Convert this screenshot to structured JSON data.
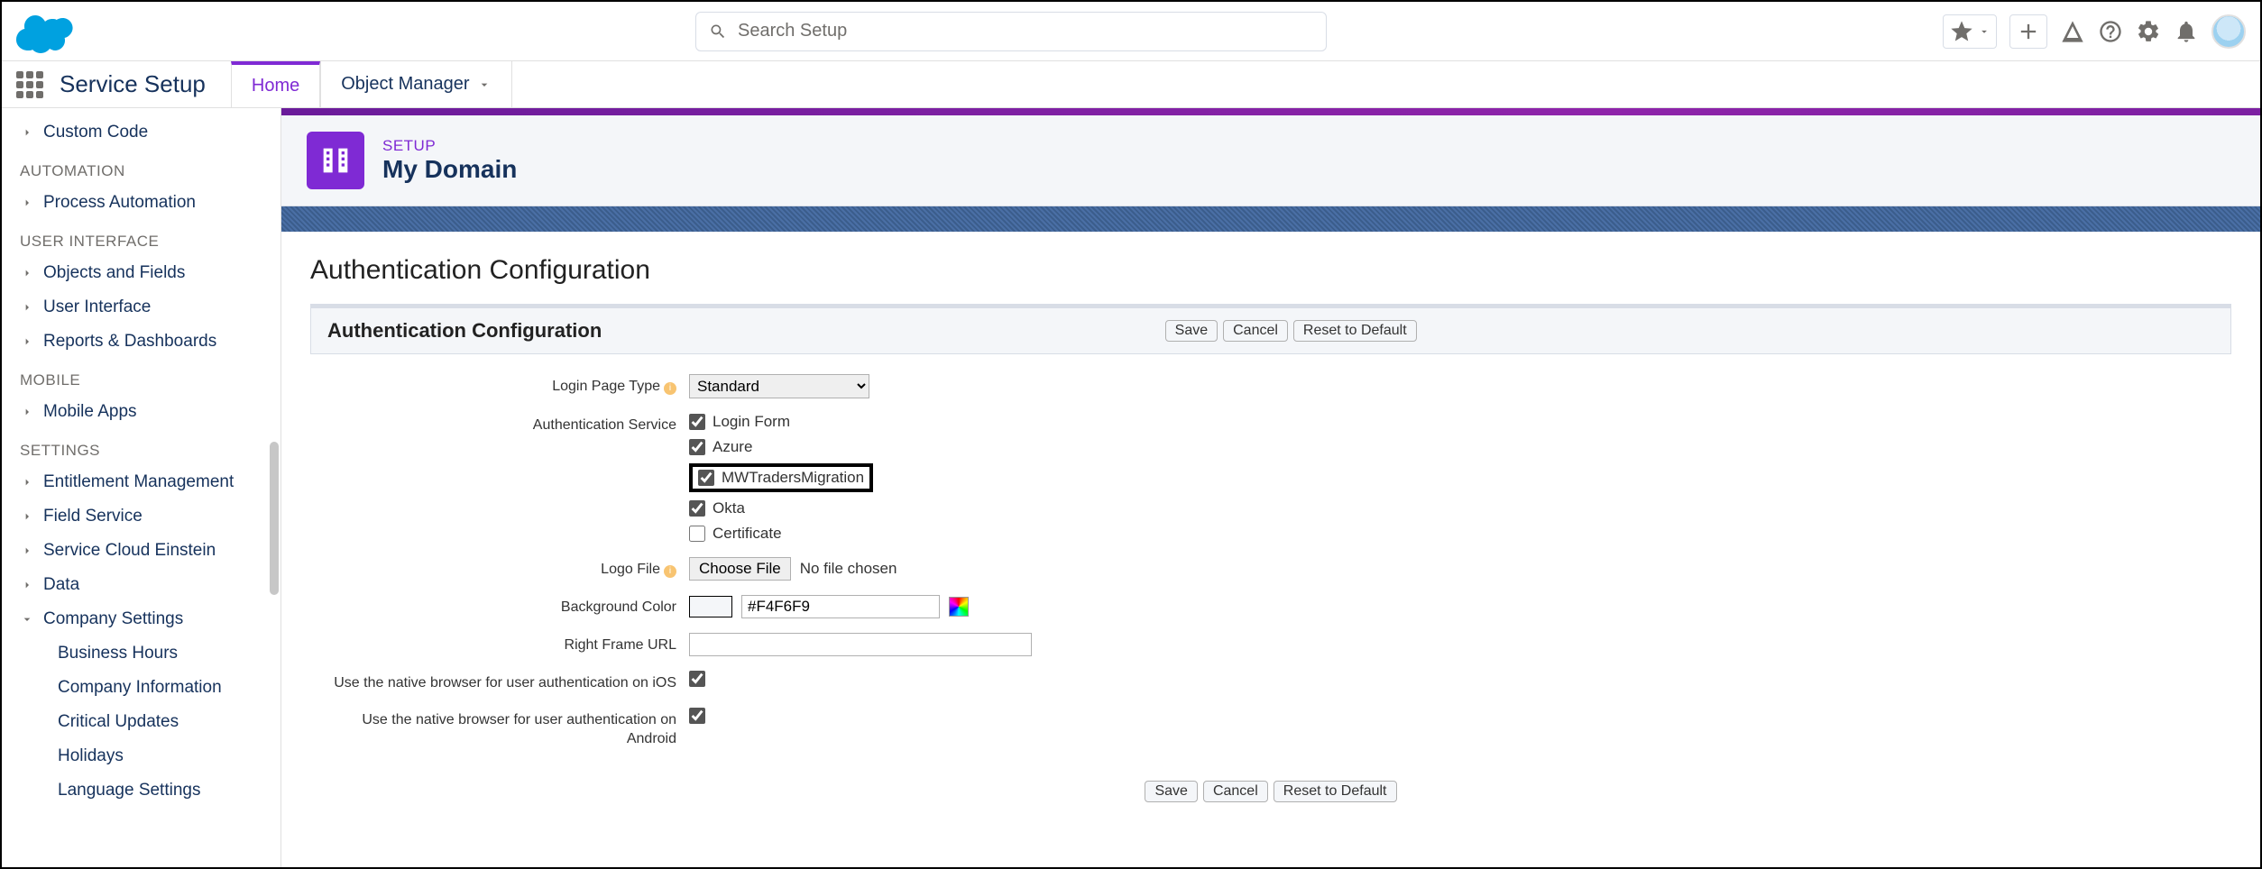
{
  "header": {
    "search_placeholder": "Search Setup"
  },
  "nav": {
    "title": "Service Setup",
    "tabs": {
      "home": "Home",
      "object_manager": "Object Manager"
    }
  },
  "sidebar": {
    "items": [
      {
        "label": "Custom Code",
        "chev": "right"
      }
    ],
    "groups": [
      {
        "head": "AUTOMATION",
        "items": [
          {
            "label": "Process Automation",
            "chev": "right"
          }
        ]
      },
      {
        "head": "USER INTERFACE",
        "items": [
          {
            "label": "Objects and Fields",
            "chev": "right"
          },
          {
            "label": "User Interface",
            "chev": "right"
          },
          {
            "label": "Reports & Dashboards",
            "chev": "right"
          }
        ]
      },
      {
        "head": "MOBILE",
        "items": [
          {
            "label": "Mobile Apps",
            "chev": "right"
          }
        ]
      },
      {
        "head": "SETTINGS",
        "items": [
          {
            "label": "Entitlement Management",
            "chev": "right"
          },
          {
            "label": "Field Service",
            "chev": "right"
          },
          {
            "label": "Service Cloud Einstein",
            "chev": "right"
          },
          {
            "label": "Data",
            "chev": "right"
          },
          {
            "label": "Company Settings",
            "chev": "down",
            "subs": [
              "Business Hours",
              "Company Information",
              "Critical Updates",
              "Holidays",
              "Language Settings"
            ]
          }
        ]
      }
    ]
  },
  "page": {
    "eyebrow": "SETUP",
    "title": "My Domain",
    "section_title": "Authentication Configuration",
    "subbar_title": "Authentication Configuration",
    "buttons": {
      "save": "Save",
      "cancel": "Cancel",
      "reset": "Reset to Default"
    },
    "form": {
      "login_page_type_label": "Login Page Type",
      "login_page_type_value": "Standard",
      "auth_service_label": "Authentication Service",
      "auth_services": [
        {
          "label": "Login Form",
          "checked": true,
          "highlight": false
        },
        {
          "label": "Azure",
          "checked": true,
          "highlight": false
        },
        {
          "label": "MWTradersMigration",
          "checked": true,
          "highlight": true
        },
        {
          "label": "Okta",
          "checked": true,
          "highlight": false
        },
        {
          "label": "Certificate",
          "checked": false,
          "highlight": false
        }
      ],
      "logo_file_label": "Logo File",
      "choose_file": "Choose File",
      "no_file": "No file chosen",
      "bg_color_label": "Background Color",
      "bg_color_value": "#F4F6F9",
      "right_frame_label": "Right Frame URL",
      "right_frame_value": "",
      "native_ios_label": "Use the native browser for user authentication on iOS",
      "native_ios_checked": true,
      "native_android_label": "Use the native browser for user authentication on Android",
      "native_android_checked": true
    }
  }
}
